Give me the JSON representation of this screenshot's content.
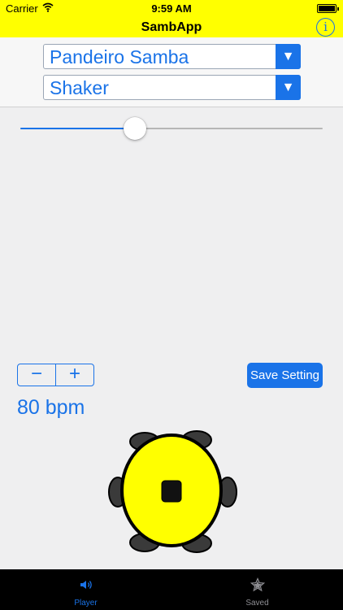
{
  "status_bar": {
    "carrier": "Carrier",
    "time": "9:59 AM",
    "battery_level": 1.0
  },
  "nav": {
    "title": "SambApp",
    "info_glyph": "i"
  },
  "selectors": {
    "rhythm": {
      "value": "Pandeiro Samba",
      "arrow": "▼"
    },
    "instrument": {
      "value": "Shaker",
      "arrow": "▼"
    }
  },
  "slider": {
    "value": 0.38
  },
  "stepper": {
    "minus": "−",
    "plus": "+"
  },
  "tempo": {
    "label": "80 bpm"
  },
  "save_button": {
    "label": "Save Setting"
  },
  "tabs": [
    {
      "label": "Player",
      "icon": "speaker-icon",
      "active": true
    },
    {
      "label": "Saved",
      "icon": "star-icon",
      "active": false
    }
  ],
  "colors": {
    "header": "#ffff00",
    "accent": "#1a73e8",
    "pandeiro_head": "#ffff00",
    "tabbar": "#000000",
    "tab_active": "#1a73e8",
    "tab_inactive": "#8e8e93"
  }
}
